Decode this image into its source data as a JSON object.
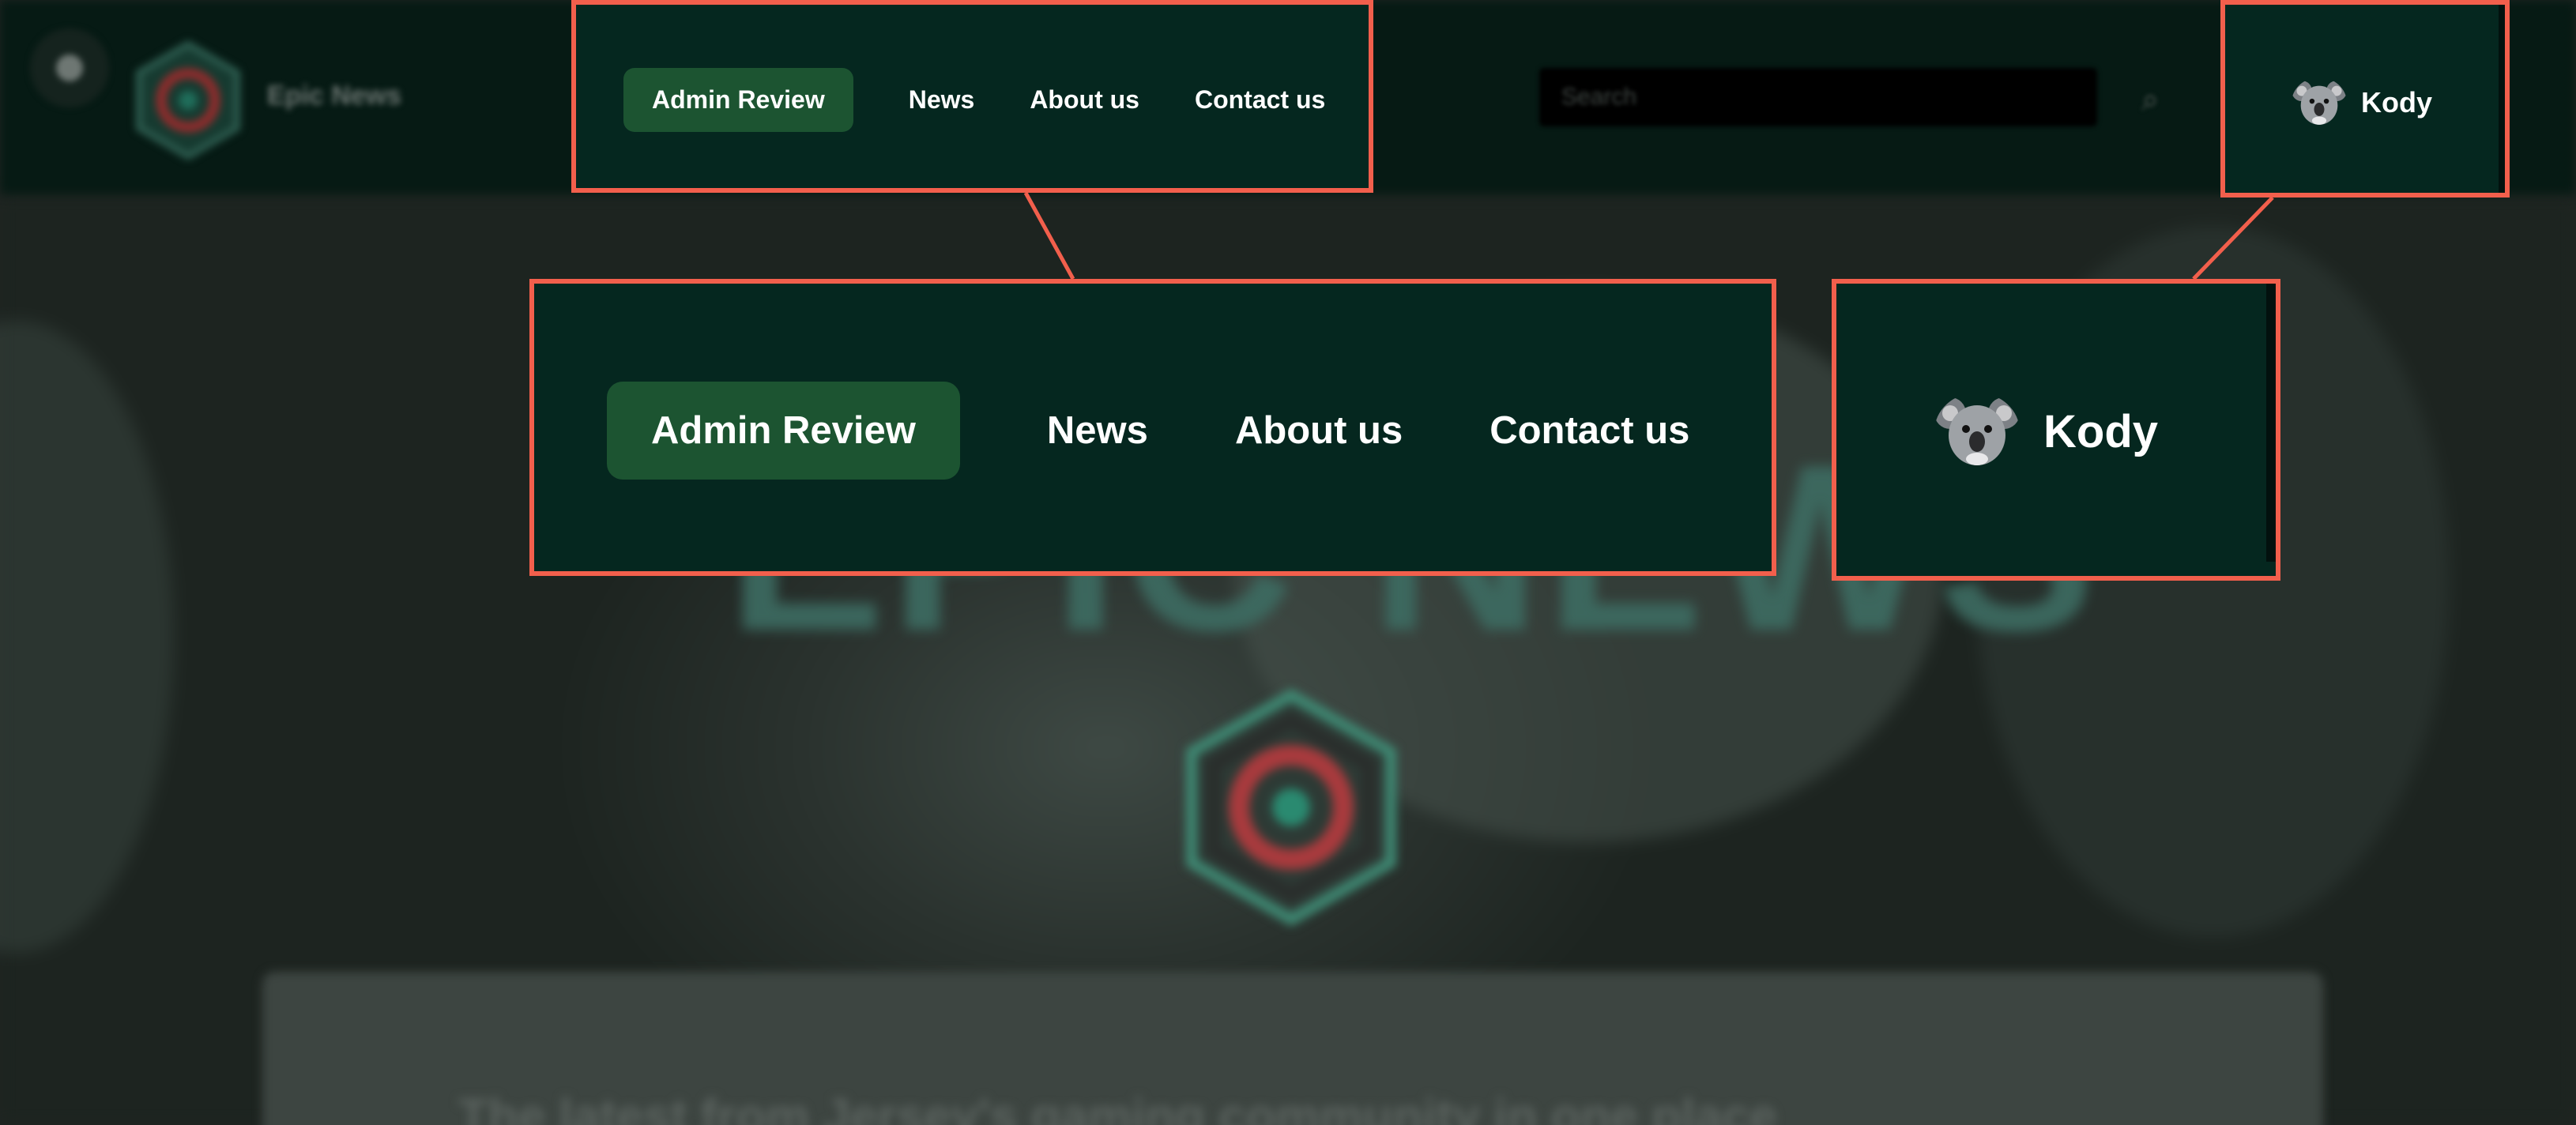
{
  "backdrop": {
    "site_name": "Epic News",
    "search_placeholder": "Search",
    "hero_title": "EPIC NEWS",
    "tagline": "The latest from Jersey's gaming community in one place"
  },
  "nav": {
    "items": [
      {
        "label": "Admin Review",
        "active": true
      },
      {
        "label": "News",
        "active": false
      },
      {
        "label": "About us",
        "active": false
      },
      {
        "label": "Contact us",
        "active": false
      }
    ]
  },
  "user": {
    "name": "Kody",
    "avatar_icon": "koala-avatar-icon"
  },
  "colors": {
    "highlight_border": "#f25f4c",
    "header_bg": "#05271f",
    "active_pill": "#1c5431",
    "text": "#ffffff"
  }
}
